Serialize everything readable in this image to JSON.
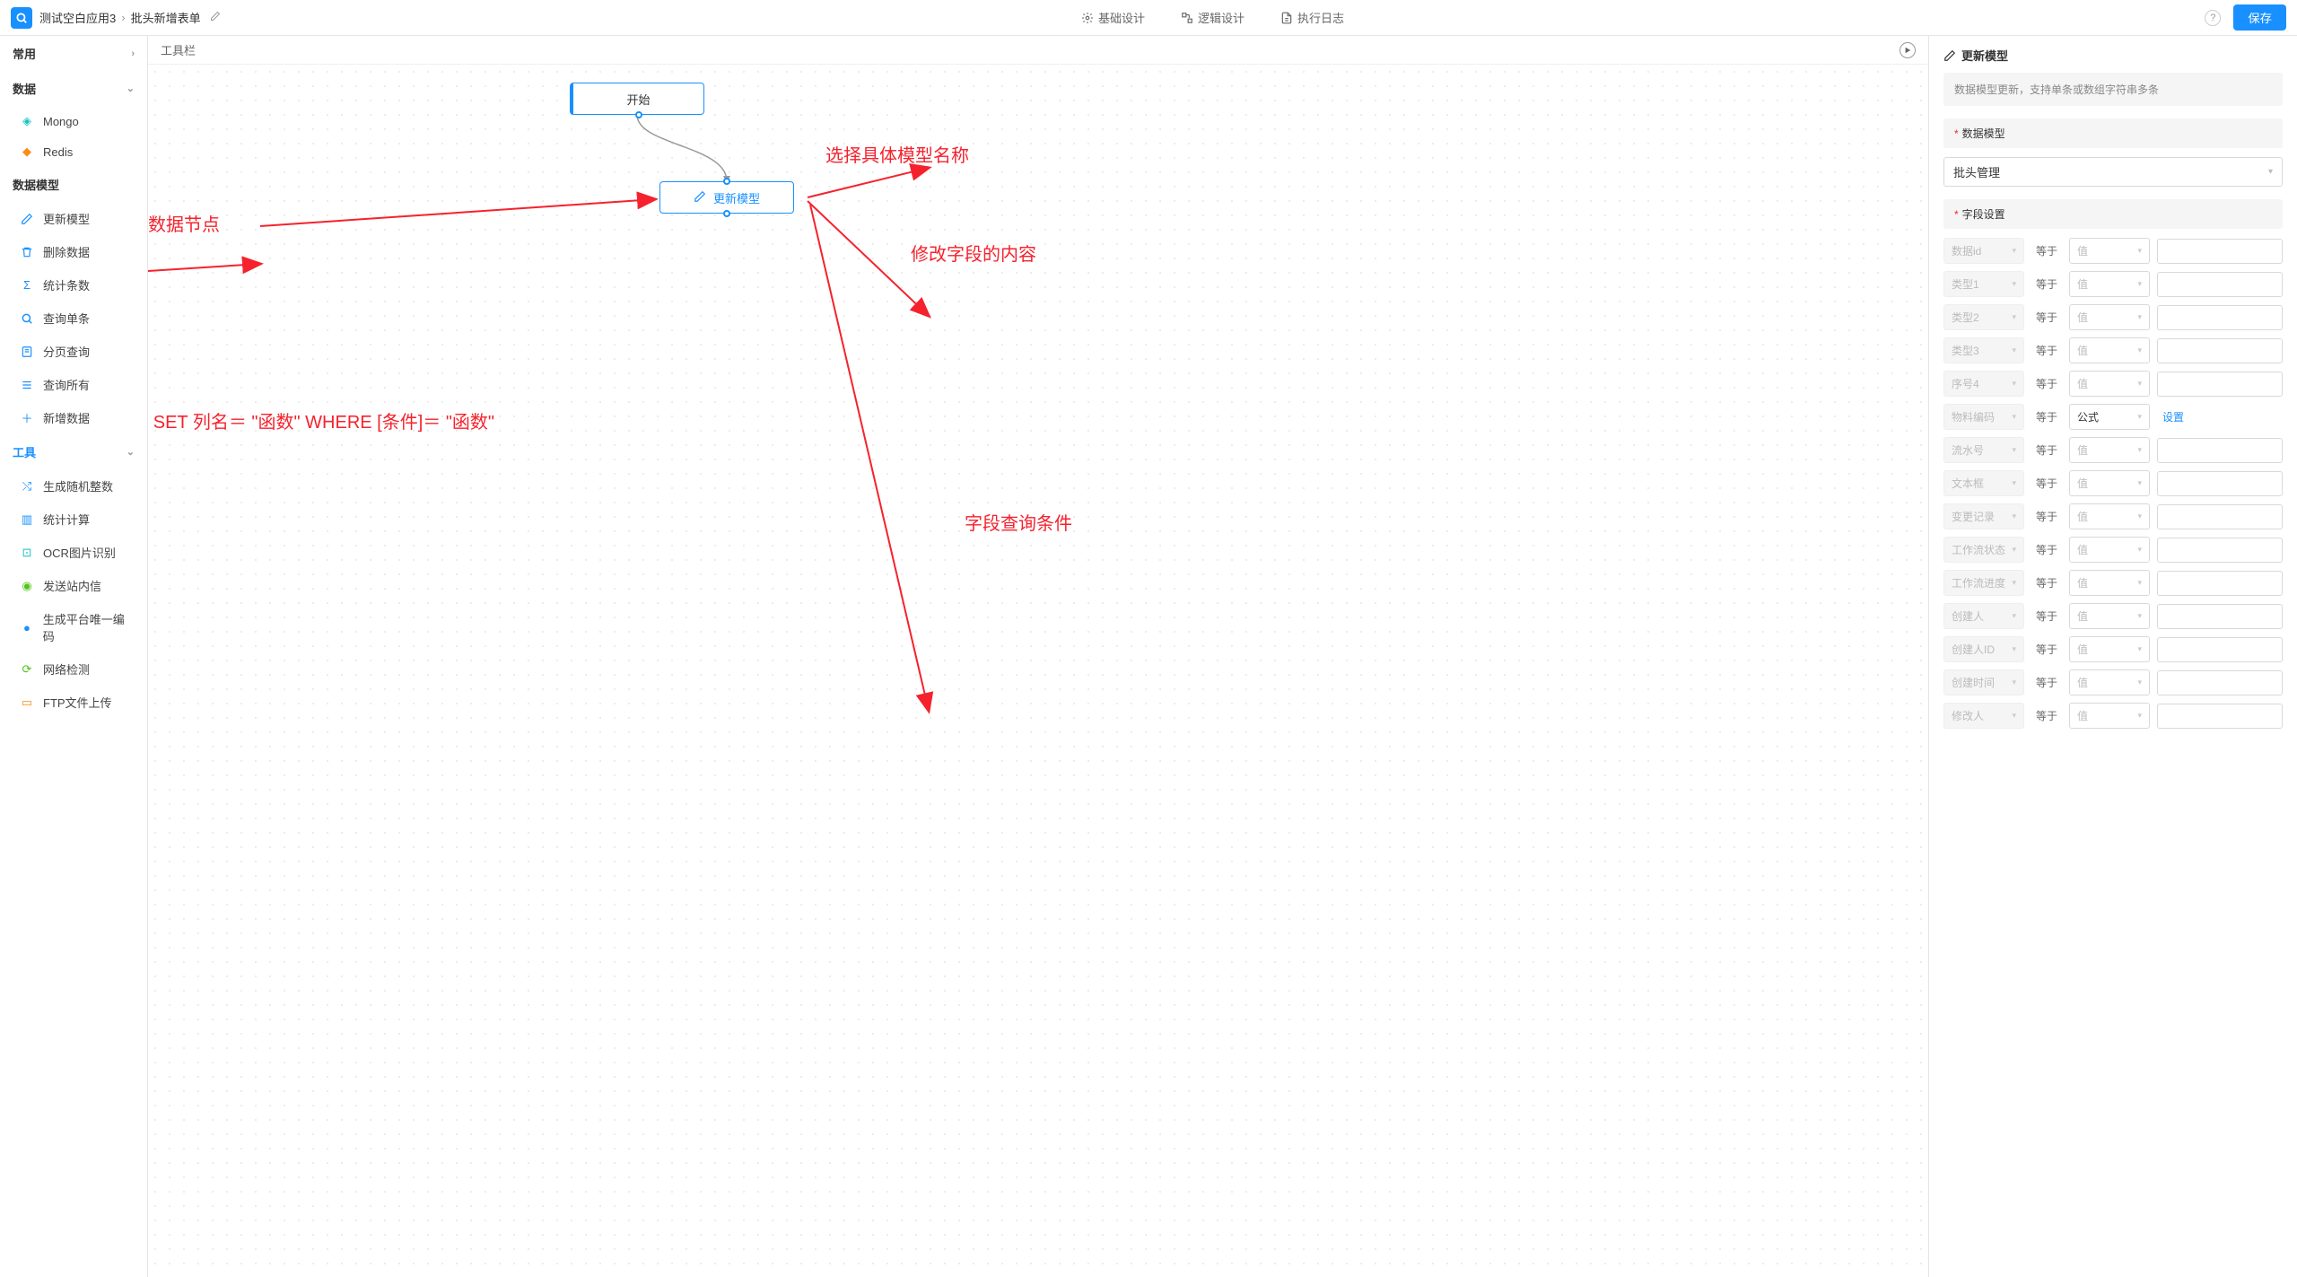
{
  "header": {
    "app_name": "测试空白应用3",
    "page_name": "批头新增表单",
    "tabs": {
      "basic": "基础设计",
      "logic": "逻辑设计",
      "log": "执行日志"
    },
    "save": "保存"
  },
  "sidebar": {
    "groups": {
      "common": "常用",
      "data": "数据",
      "datamodel": "数据模型",
      "tools": "工具"
    },
    "data_items": [
      {
        "label": "Mongo"
      },
      {
        "label": "Redis"
      }
    ],
    "dm_items": [
      {
        "label": "更新模型"
      },
      {
        "label": "删除数据"
      },
      {
        "label": "统计条数"
      },
      {
        "label": "查询单条"
      },
      {
        "label": "分页查询"
      },
      {
        "label": "查询所有"
      },
      {
        "label": "新增数据"
      }
    ],
    "tool_items": [
      {
        "label": "生成随机整数"
      },
      {
        "label": "统计计算"
      },
      {
        "label": "OCR图片识别"
      },
      {
        "label": "发送站内信"
      },
      {
        "label": "生成平台唯一编码"
      },
      {
        "label": "网络检测"
      },
      {
        "label": "FTP文件上传"
      }
    ]
  },
  "canvas": {
    "toolbar": "工具栏",
    "start_node": "开始",
    "update_node": "更新模型"
  },
  "props": {
    "title": "更新模型",
    "desc": "数据模型更新，支持单条或数组字符串多条",
    "section_model": "数据模型",
    "model_value": "批头管理",
    "section_fields": "字段设置",
    "op_eq": "等于",
    "val_placeholder": "值",
    "formula_label": "公式",
    "set_link": "设置",
    "rows": [
      {
        "field": "数据id",
        "mode": "value"
      },
      {
        "field": "类型1",
        "mode": "value"
      },
      {
        "field": "类型2",
        "mode": "value"
      },
      {
        "field": "类型3",
        "mode": "value"
      },
      {
        "field": "序号4",
        "mode": "value"
      },
      {
        "field": "物料编码",
        "mode": "formula"
      },
      {
        "field": "流水号",
        "mode": "value"
      },
      {
        "field": "文本框",
        "mode": "value"
      },
      {
        "field": "变更记录",
        "mode": "value"
      },
      {
        "field": "工作流状态",
        "mode": "value"
      },
      {
        "field": "工作流进度",
        "mode": "value"
      },
      {
        "field": "创建人",
        "mode": "value"
      },
      {
        "field": "创建人ID",
        "mode": "value"
      },
      {
        "field": "创建时间",
        "mode": "value"
      },
      {
        "field": "修改人",
        "mode": "value"
      }
    ]
  },
  "annotations": {
    "a1": "更新数据节点",
    "a2": "选择具体模型名称",
    "a3": "修改字段的内容",
    "a4": "字段查询条件",
    "a5": "UPDATE 模型名称 SET 列名＝ \"函数\"  WHERE [条件]＝ \"函数\""
  }
}
